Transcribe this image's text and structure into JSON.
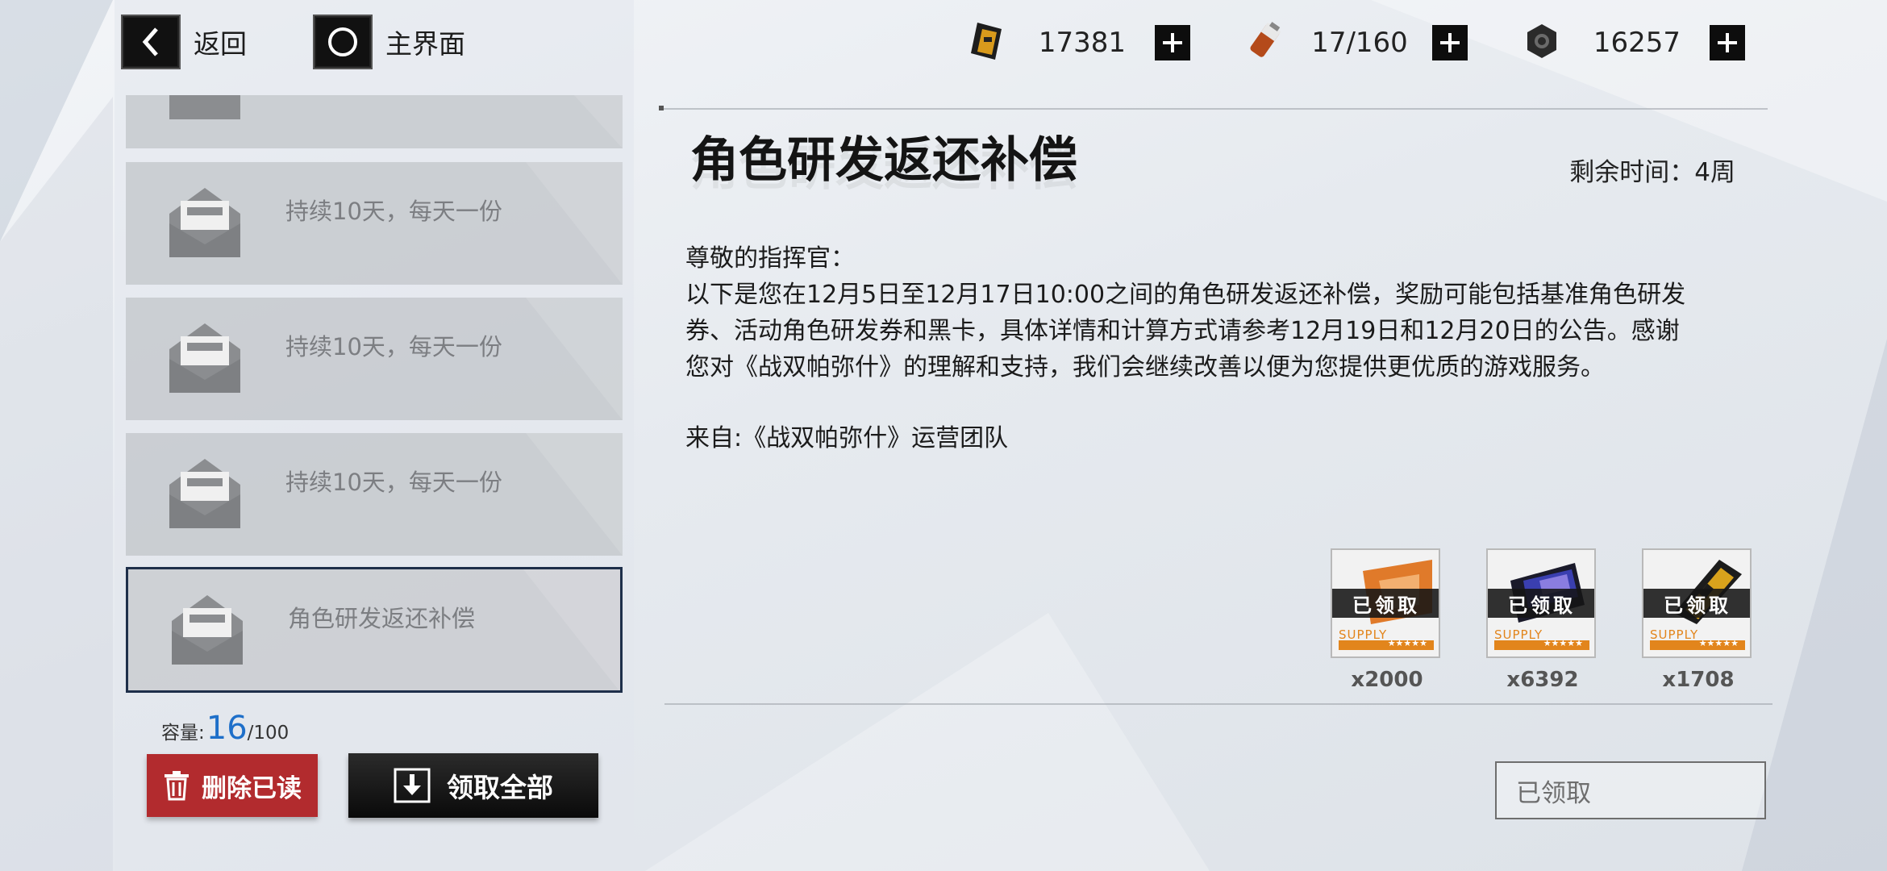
{
  "nav": {
    "back_label": "返回",
    "home_label": "主界面"
  },
  "resources": [
    {
      "icon": "ticket-icon",
      "value": "17381"
    },
    {
      "icon": "battery-icon",
      "value": "17/160"
    },
    {
      "icon": "nut-icon",
      "value": "16257"
    }
  ],
  "mails": [
    {
      "subject": ""
    },
    {
      "subject": "持续10天，每天一份"
    },
    {
      "subject": "持续10天，每天一份"
    },
    {
      "subject": "持续10天，每天一份"
    },
    {
      "subject": "角色研发返还补偿"
    }
  ],
  "capacity": {
    "label": "容量:",
    "count": "16",
    "max": "/100"
  },
  "buttons": {
    "delete_read": "删除已读",
    "claim_all": "领取全部",
    "claimed": "已领取"
  },
  "detail": {
    "title": "角色研发返还补偿",
    "remaining": "剩余时间：4周",
    "body": [
      "尊敬的指挥官：",
      "以下是您在12月5日至12月17日10:00之间的角色研发返还补偿，奖励可能包括基准角色研发",
      "券、活动角色研发券和黑卡，具体详情和计算方式请参考12月19日和12月20日的公告。感谢",
      "您对《战双帕弥什》的理解和支持，我们会继续改善以便为您提供更优质的游戏服务。"
    ],
    "from": "来自:《战双帕弥什》运营团队"
  },
  "rewards": [
    {
      "status": "已领取",
      "supply": "SUPPLY",
      "stars": "★★★★★",
      "count": "x2000",
      "color": "#e07a2a"
    },
    {
      "status": "已领取",
      "supply": "SUPPLY",
      "stars": "★★★★★",
      "count": "x6392",
      "color": "#3a3fb0"
    },
    {
      "status": "已领取",
      "supply": "SUPPLY",
      "stars": "★★★★★",
      "count": "x1708",
      "color": "#d8a21c"
    }
  ]
}
